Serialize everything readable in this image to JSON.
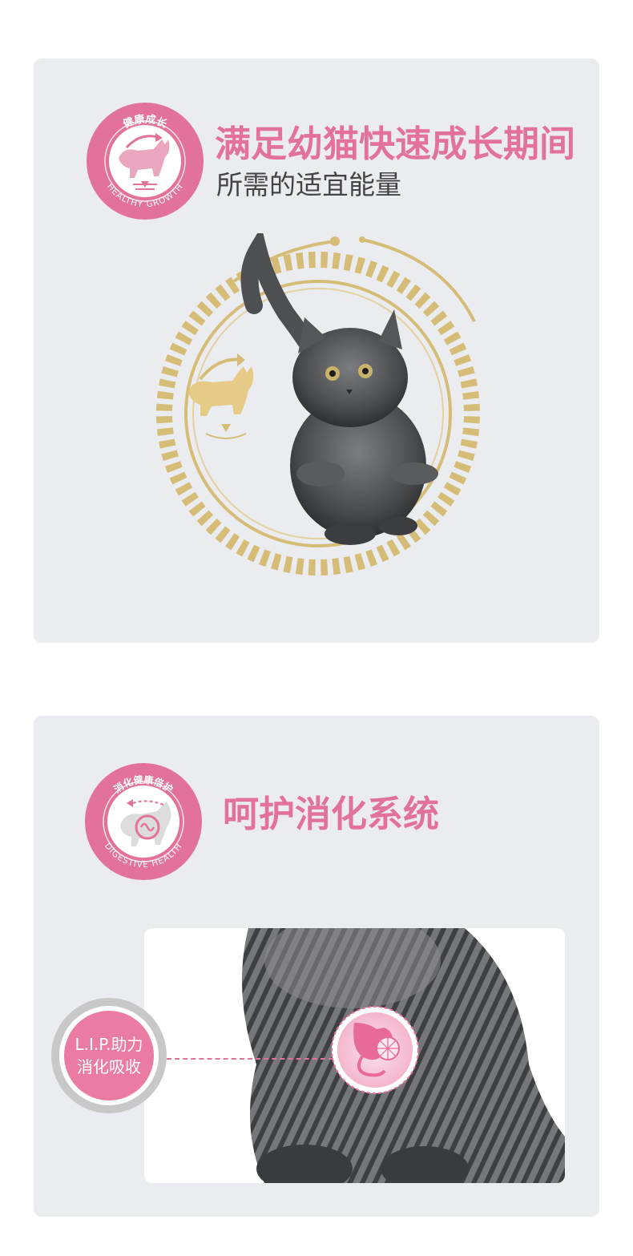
{
  "colors": {
    "accent_pink": "#e2729a",
    "gold": "#d6bd77",
    "panel_bg": "#ebecef"
  },
  "section_growth": {
    "badge": {
      "top_text": "健康成长",
      "bottom_text": "HEALTHY GROWTH",
      "icon": "kitten-growth-icon"
    },
    "headline": "满足幼猫快速成长期间",
    "subline": "所需的适宜能量",
    "illustration": "kitten-with-gold-ring"
  },
  "section_digestive": {
    "badge": {
      "top_text": "消化健康倍护",
      "bottom_text": "DIGESTIVE HEALTH",
      "icon": "digestive-icon"
    },
    "headline": "呵护消化系统",
    "callout": {
      "line1": "L.I.P.助力",
      "line2": "消化吸收"
    },
    "illustration": "kitten-photo-with-stomach-icon"
  }
}
